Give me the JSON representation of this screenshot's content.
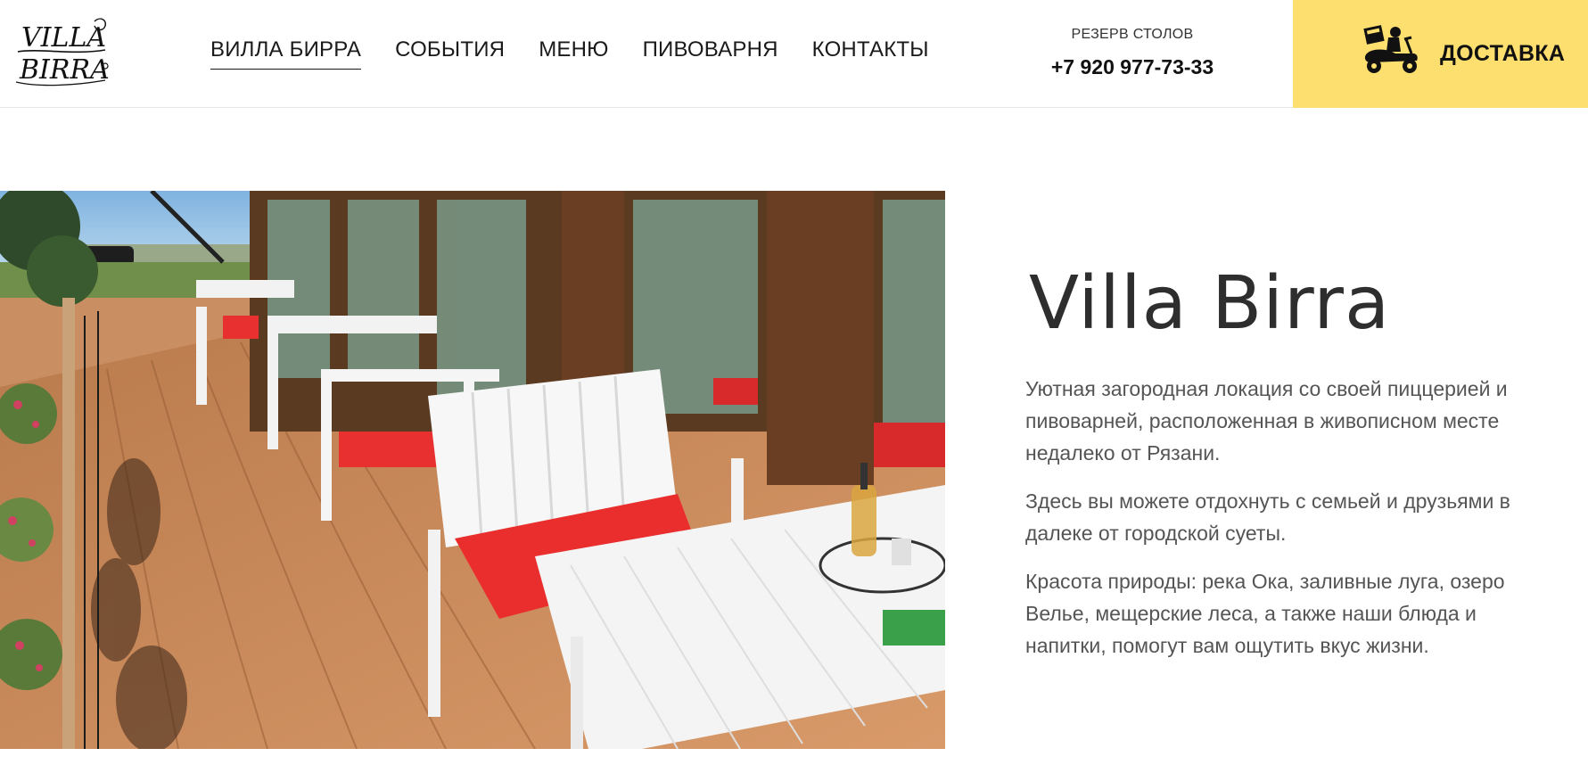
{
  "header": {
    "logo": {
      "line1": "VILLA",
      "line2": "BIRRA",
      "icon": "villa-birra-logo"
    },
    "nav": [
      {
        "label": "ВИЛЛА БИРРА",
        "active": true
      },
      {
        "label": "СОБЫТИЯ",
        "active": false
      },
      {
        "label": "МЕНЮ",
        "active": false
      },
      {
        "label": "ПИВОВАРНЯ",
        "active": false
      },
      {
        "label": "КОНТАКТЫ",
        "active": false
      }
    ],
    "reserve": {
      "label": "РЕЗЕРВ СТОЛОВ",
      "phone": "+7 920 977-73-33"
    },
    "delivery": {
      "label": "ДОСТАВКА",
      "icon": "delivery-scooter-icon",
      "background": "#fddf6f"
    }
  },
  "hero": {
    "image": "terrace-photo",
    "title": "Villa Birra",
    "paragraphs": [
      "Уютная загородная локация со своей пиццерией и пивоварней, расположенная в живописном месте недалеко от Рязани.",
      "Здесь вы можете отдохнуть с семьей и друзьями в далеке от городской суеты.",
      "Красота природы: река Ока, заливные луга, озеро Велье, мещерские леса, а также наши блюда и напитки, помогут вам ощутить вкус жизни."
    ]
  },
  "colors": {
    "accent": "#fddf6f",
    "text": "#222222",
    "muted": "#555555"
  }
}
